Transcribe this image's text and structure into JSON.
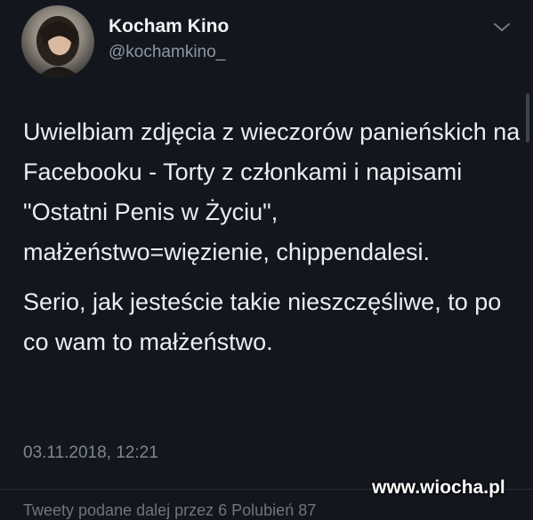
{
  "tweet": {
    "display_name": "Kocham Kino",
    "handle": "@kochamkino_",
    "paragraphs": [
      "Uwielbiam zdjęcia z wieczorów panieńskich na Facebooku - Torty z członkami i napisami \"Ostatni Penis w Życiu\", małżeństwo=więzienie, chippendalesi.",
      "Serio, jak jesteście takie nieszczęśliwe, to po co wam to małżeństwo."
    ],
    "timestamp": "03.11.2018, 12:21",
    "bottom_partial": "Tweety podane dalej przez 6   Polubień 87"
  },
  "icons": {
    "menu": "chevron-down-icon"
  },
  "watermark": "www.wiocha.pl",
  "colors": {
    "background": "#13161d",
    "text": "#e9eef2",
    "secondary": "#8b97a3"
  }
}
